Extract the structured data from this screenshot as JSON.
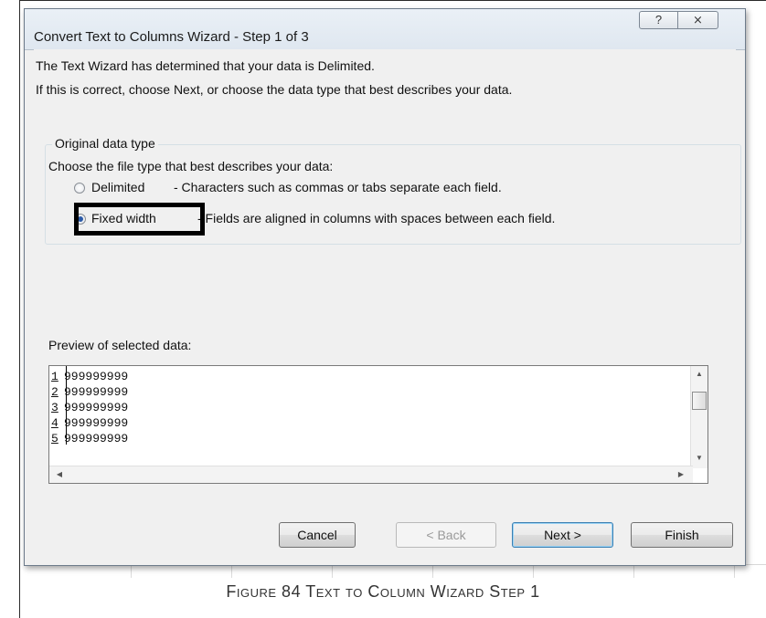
{
  "dialog": {
    "title": "Convert Text to Columns Wizard - Step 1 of 3",
    "help_glyph": "?",
    "close_glyph": "⨯",
    "intro_line1": "The Text Wizard has determined that your data is Delimited.",
    "intro_line2": "If this is correct, choose Next, or choose the data type that best describes your data.",
    "group_label": "Original data type",
    "choose_label": "Choose the file type that best describes your data:",
    "options": [
      {
        "label": "Delimited",
        "description": "- Characters such as commas or tabs separate each field.",
        "selected": false
      },
      {
        "label": "Fixed width",
        "description": "- Fields are aligned in columns with spaces between each field.",
        "selected": true
      }
    ],
    "preview_label": "Preview of selected data:",
    "preview_rows": [
      {
        "num": "1",
        "text": "999999999"
      },
      {
        "num": "2",
        "text": "999999999"
      },
      {
        "num": "3",
        "text": "999999999"
      },
      {
        "num": "4",
        "text": "999999999"
      },
      {
        "num": "5",
        "text": "999999999"
      }
    ],
    "buttons": {
      "cancel": "Cancel",
      "back": "< Back",
      "next": "Next >",
      "finish": "Finish"
    }
  },
  "caption": "Figure 84 Text to Column Wizard Step 1"
}
